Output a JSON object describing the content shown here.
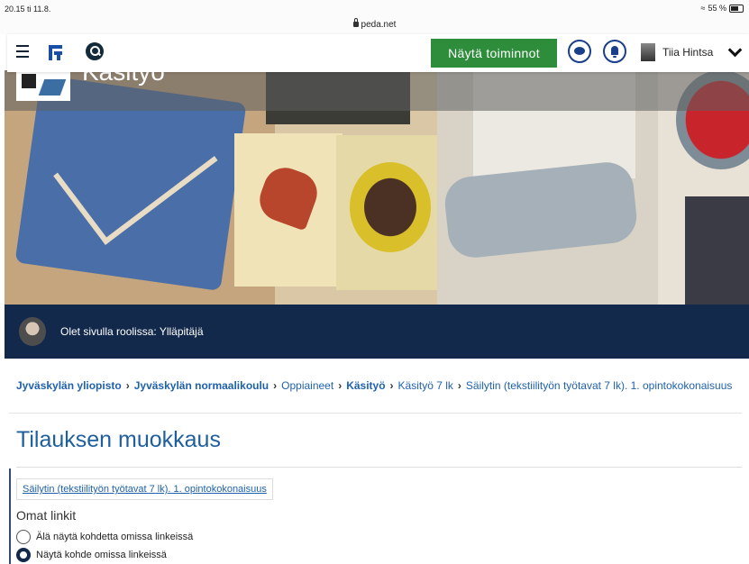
{
  "status_bar": {
    "time": "20.15  ti 11.8.",
    "url": "peda.net",
    "battery": "55 %"
  },
  "header": {
    "actions_button": "Näytä toiminnot",
    "user_name": "Tiia Hintsa",
    "icons": [
      "menu-icon",
      "peda-logo-icon",
      "search-icon",
      "chat-icon",
      "bell-icon",
      "chevron-down-icon"
    ]
  },
  "banner": {
    "site_title": "Käsityö"
  },
  "role_bar": {
    "text": "Olet sivulla roolissa: Ylläpitäjä"
  },
  "breadcrumb": [
    {
      "label": "Jyväskylän yliopisto",
      "bold": true
    },
    {
      "label": "Jyväskylän normaalikoulu",
      "bold": true
    },
    {
      "label": "Oppiaineet",
      "bold": false
    },
    {
      "label": "Käsityö",
      "bold": true
    },
    {
      "label": "Käsityö 7 lk",
      "bold": false
    },
    {
      "label": "Säilytin (tekstiilityön työtavat 7 lk). 1. opintokokonaisuus",
      "bold": false
    }
  ],
  "main": {
    "page_title": "Tilauksen muokkaus",
    "item_link": "Säilytin (tekstiilityön työtavat 7 lk). 1. opintokokonaisuus",
    "section_label": "Omat linkit",
    "options": [
      {
        "label": "Älä näytä kohdetta omissa linkeissä",
        "selected": false
      },
      {
        "label": "Näytä kohde omissa linkeissä",
        "selected": true
      }
    ]
  },
  "colors": {
    "action_green": "#2d8d3b",
    "navy": "#13294b",
    "link_blue": "#1f61ad"
  }
}
